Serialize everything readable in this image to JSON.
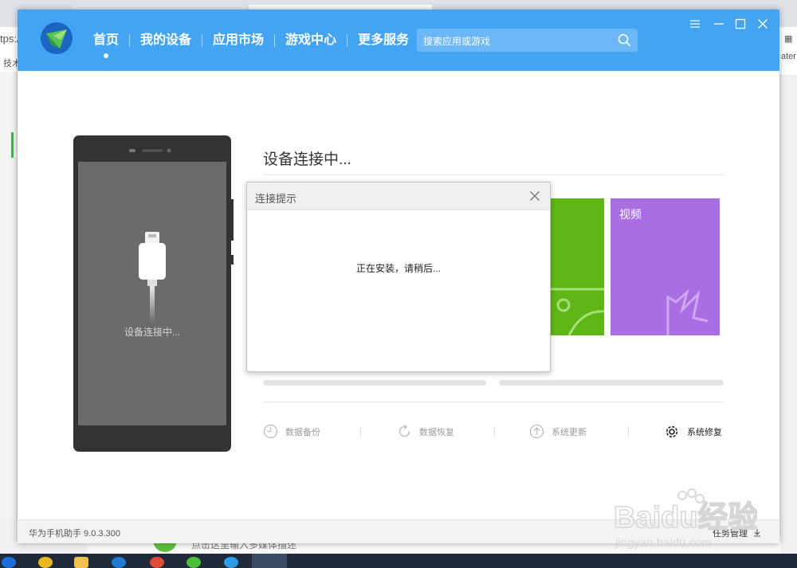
{
  "app": {
    "nav": [
      {
        "label": "首页",
        "active": true
      },
      {
        "label": "我的设备",
        "active": false
      },
      {
        "label": "应用市场",
        "active": false
      },
      {
        "label": "游戏中心",
        "active": false
      },
      {
        "label": "更多服务",
        "active": false
      }
    ],
    "search_placeholder": "搜索应用或游戏",
    "accent_color": "#44a4f4"
  },
  "phone": {
    "status": "设备连接中..."
  },
  "main": {
    "status_title": "设备连接中...",
    "tile_video_label": "视频",
    "actions": [
      {
        "label": "数据备份",
        "icon": "backup-icon"
      },
      {
        "label": "数据恢复",
        "icon": "restore-icon"
      },
      {
        "label": "系统更新",
        "icon": "update-icon"
      },
      {
        "label": "系统修复",
        "icon": "gear-icon"
      }
    ]
  },
  "dialog": {
    "title": "连接提示",
    "message": "正在安装，请稍后..."
  },
  "footer": {
    "version": "华为手机助手 9.0.3.300",
    "task_manager": "任务管理"
  },
  "background": {
    "url_fragment": "tps:/",
    "bookmark_fragment": "技术",
    "right_fragment": "ater",
    "bottom_text": "点击这里输入多媒体描述"
  },
  "watermark": {
    "text": "Baidu经验",
    "sub": "jingyan.baidu.com"
  }
}
